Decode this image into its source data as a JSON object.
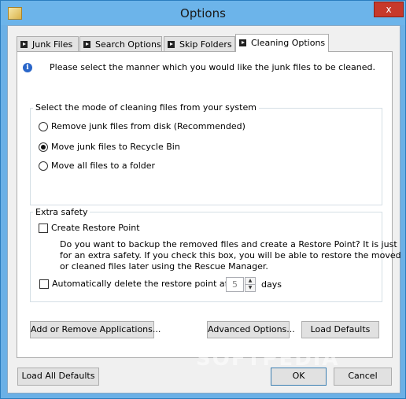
{
  "window": {
    "title": "Options",
    "close_label": "x"
  },
  "tabs": [
    {
      "label": "Junk Files",
      "active": false
    },
    {
      "label": "Search Options",
      "active": false
    },
    {
      "label": "Skip Folders",
      "active": false
    },
    {
      "label": "Cleaning Options",
      "active": true
    }
  ],
  "info": {
    "text": "Please select the manner which you would like the junk files to be cleaned.",
    "icon": "i"
  },
  "mode_group": {
    "title": "Select the mode of cleaning files from your system",
    "options": [
      {
        "label": "Remove junk files from disk (Recommended)",
        "checked": false
      },
      {
        "label": "Move junk files to Recycle Bin",
        "checked": true
      },
      {
        "label": "Move all files to a folder",
        "checked": false
      }
    ]
  },
  "safety_group": {
    "title": "Extra safety",
    "restore_point_label": "Create Restore Point",
    "restore_point_checked": false,
    "description": [
      "Do you want to backup the removed files and create a Restore Point? It is just",
      "for an extra safety. If you check this box, you will be able to restore the moved",
      "or cleaned files later using the Rescue Manager."
    ],
    "auto_delete_label": "Automatically delete the restore point after",
    "auto_delete_checked": false,
    "days_value": "5",
    "days_unit": "days"
  },
  "panel_buttons": {
    "add_remove": "Add or Remove Applications...",
    "advanced": "Advanced Options...",
    "load_defaults": "Load Defaults"
  },
  "footer": {
    "load_all_defaults": "Load All Defaults",
    "ok": "OK",
    "cancel": "Cancel"
  },
  "watermark": "SOFTPEDIA",
  "colors": {
    "titlebar": "#6cb4ea",
    "close": "#c7392b",
    "panel": "#ffffff",
    "dialog": "#f0f0f0"
  }
}
